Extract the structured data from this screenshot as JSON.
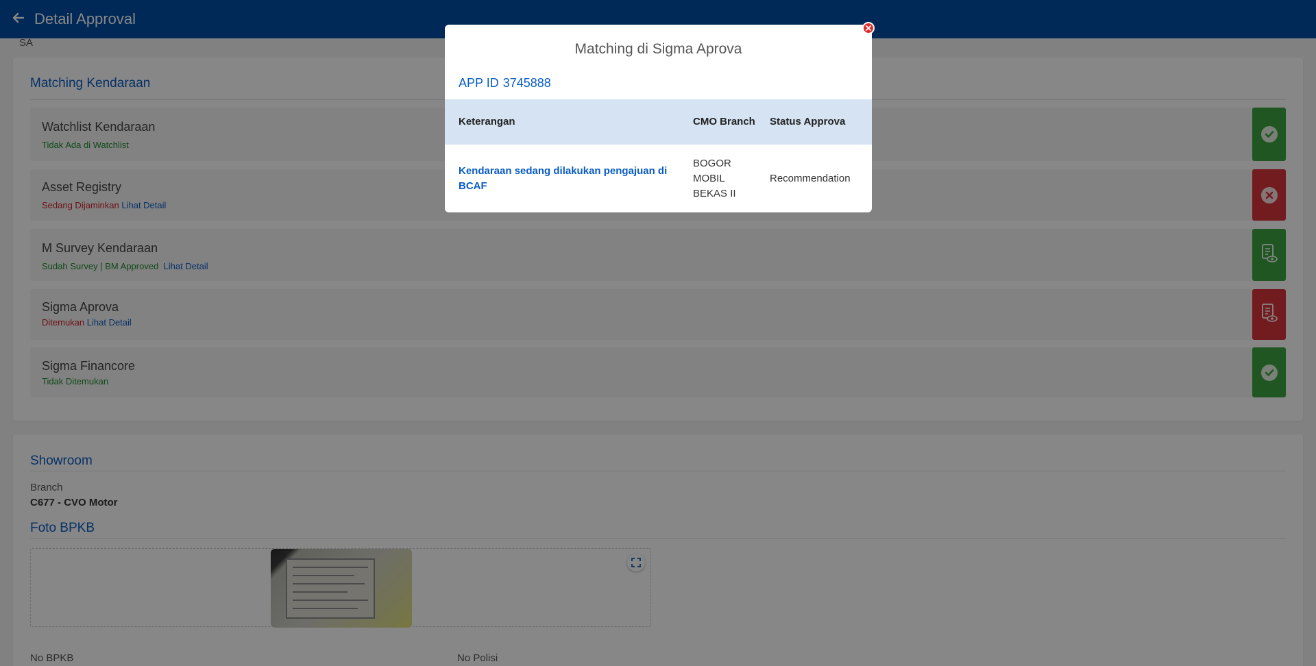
{
  "header": {
    "back_icon": "arrow-left-icon",
    "title": "Detail Approval"
  },
  "sub_label": "SA",
  "matching": {
    "title": "Matching Kendaraan",
    "rows": [
      {
        "name": "Watchlist Kendaraan",
        "status": "Tidak Ada di Watchlist",
        "status_color": "#1f8a2e",
        "link": "",
        "badge": "check-circle-icon",
        "badge_color": "#3ea33f"
      },
      {
        "name": "Asset Registry",
        "status": "Sedang Dijaminkan",
        "status_color": "#d0202a",
        "link": "Lihat Detail",
        "badge": "x-circle-icon",
        "badge_color": "#d9363e"
      },
      {
        "name": "M Survey Kendaraan",
        "status": "Sudah Survey | BM Approved",
        "status_color": "#1f8a2e",
        "link": "Lihat Detail",
        "badge": "document-view-icon",
        "badge_color": "#3ea33f"
      },
      {
        "name": "Sigma Aprova",
        "status": "Ditemukan",
        "status_color": "#d0202a",
        "link": "Lihat Detail",
        "badge": "document-view-icon",
        "badge_color": "#d9363e"
      },
      {
        "name": "Sigma Financore",
        "status": "Tidak Ditemukan",
        "status_color": "#1f8a2e",
        "link": "",
        "badge": "check-circle-icon",
        "badge_color": "#3ea33f"
      }
    ]
  },
  "showroom": {
    "title": "Showroom",
    "branch_label": "Branch",
    "branch_value": "C677 - CVO Motor",
    "foto_title": "Foto BPKB",
    "expand_icon": "expand-icon",
    "no_bpkb_label": "No BPKB",
    "no_polisi_label": "No Polisi"
  },
  "modal": {
    "title": "Matching di Sigma Aprova",
    "close_icon": "close-icon",
    "appid_label": "APP ID",
    "appid_value": "3745888",
    "headers": {
      "keterangan": "Keterangan",
      "cmo_branch": "CMO Branch",
      "status": "Status Approva"
    },
    "rows": [
      {
        "keterangan": "Kendaraan sedang dilakukan pengajuan di BCAF",
        "cmo_branch": "BOGOR MOBIL BEKAS II",
        "status": "Recommendation"
      }
    ]
  }
}
